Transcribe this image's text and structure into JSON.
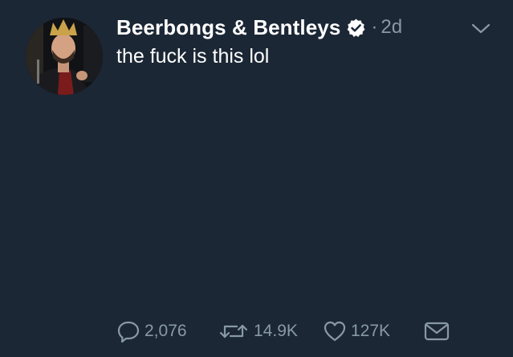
{
  "tweet": {
    "author_name": "Beerbongs & Bentleys",
    "separator": "·",
    "time": "2d",
    "text": "the fuck is this lol",
    "verified": true,
    "actions": {
      "replies": "2,076",
      "retweets": "14.9K",
      "likes": "127K"
    }
  },
  "colors": {
    "background": "#1c2735",
    "text_primary": "#ffffff",
    "text_secondary": "#8899a6"
  },
  "icons": {
    "verified": "verified-badge-icon",
    "caret": "chevron-down-icon",
    "reply": "reply-bubble-icon",
    "retweet": "retweet-icon",
    "like": "heart-icon",
    "message": "envelope-icon"
  }
}
